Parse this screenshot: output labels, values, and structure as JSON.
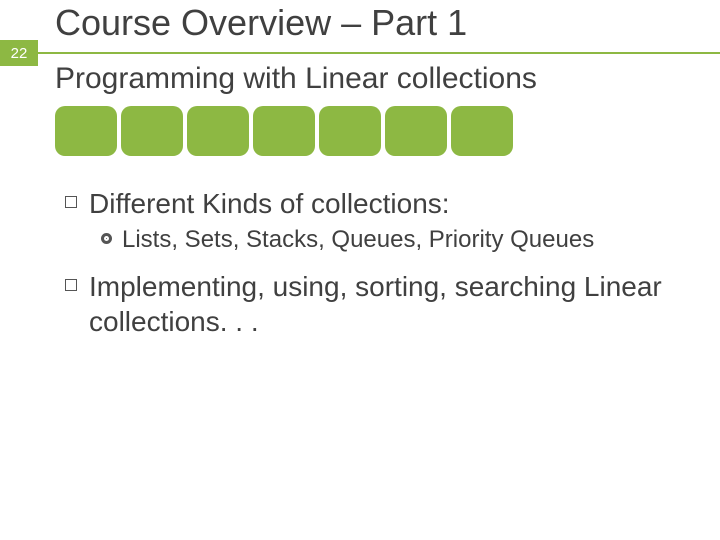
{
  "page_number": "22",
  "title": "Course Overview – Part 1",
  "subtitle": "Programming with Linear collections",
  "box_count": 7,
  "bullets": [
    {
      "level": 1,
      "text": "Different Kinds of collections:",
      "children": [
        {
          "level": 2,
          "text": "Lists, Sets, Stacks, Queues, Priority Queues"
        }
      ]
    },
    {
      "level": 1,
      "text": "Implementing, using, sorting, searching Linear collections. . .",
      "children": []
    }
  ],
  "colors": {
    "accent": "#8db843",
    "text": "#404040"
  }
}
